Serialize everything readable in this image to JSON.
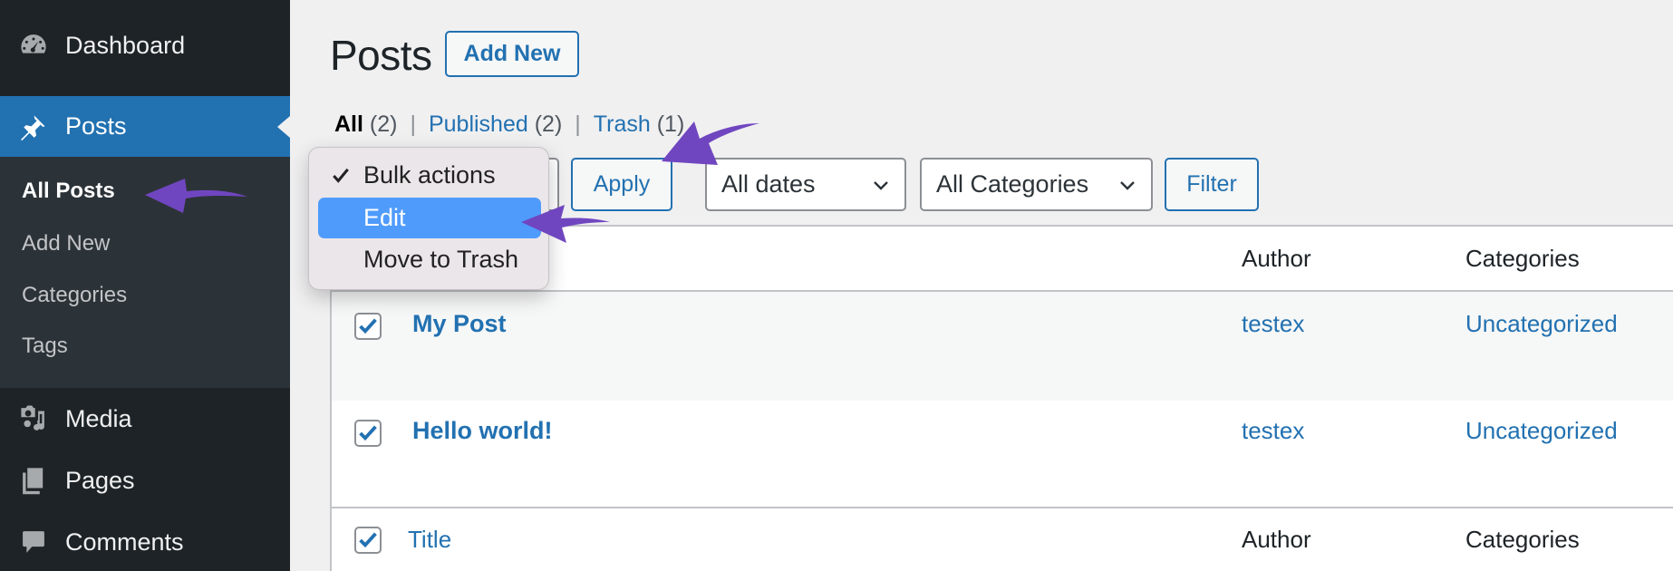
{
  "sidebar": {
    "items": [
      {
        "label": "Dashboard",
        "icon": "dashboard-gauge-icon"
      },
      {
        "label": "Posts",
        "icon": "pushpin-icon",
        "active": true
      },
      {
        "label": "Media",
        "icon": "media-camera-music-icon"
      },
      {
        "label": "Pages",
        "icon": "pages-icon"
      },
      {
        "label": "Comments",
        "icon": "comment-bubble-icon"
      }
    ],
    "submenu": [
      {
        "label": "All Posts",
        "current": true
      },
      {
        "label": "Add New"
      },
      {
        "label": "Categories"
      },
      {
        "label": "Tags"
      }
    ]
  },
  "header": {
    "title": "Posts",
    "add_new_label": "Add New"
  },
  "views": {
    "all": {
      "label": "All",
      "count": "(2)"
    },
    "published": {
      "label": "Published",
      "count": "(2)"
    },
    "trash": {
      "label": "Trash",
      "count": "(1)"
    },
    "separator": "|"
  },
  "toolbar": {
    "bulk_actions": {
      "selected": "Bulk actions",
      "options": [
        "Bulk actions",
        "Edit",
        "Move to Trash"
      ],
      "highlighted": "Edit"
    },
    "apply_label": "Apply",
    "dates_filter": "All dates",
    "categories_filter": "All Categories",
    "filter_label": "Filter"
  },
  "table": {
    "columns": [
      "Title",
      "Author",
      "Categories"
    ],
    "rows": [
      {
        "title": "My Post",
        "author": "testex",
        "categories": "Uncategorized",
        "checked": true
      },
      {
        "title": "Hello world!",
        "author": "testex",
        "categories": "Uncategorized",
        "checked": true
      }
    ],
    "header_checked": true,
    "footer_checked": true
  },
  "colors": {
    "sidebar_bg": "#1d2327",
    "submenu_bg": "#2c3338",
    "accent": "#2271b1",
    "menu_highlight": "#4f9bfc",
    "annotation_arrow": "#7046c0"
  }
}
